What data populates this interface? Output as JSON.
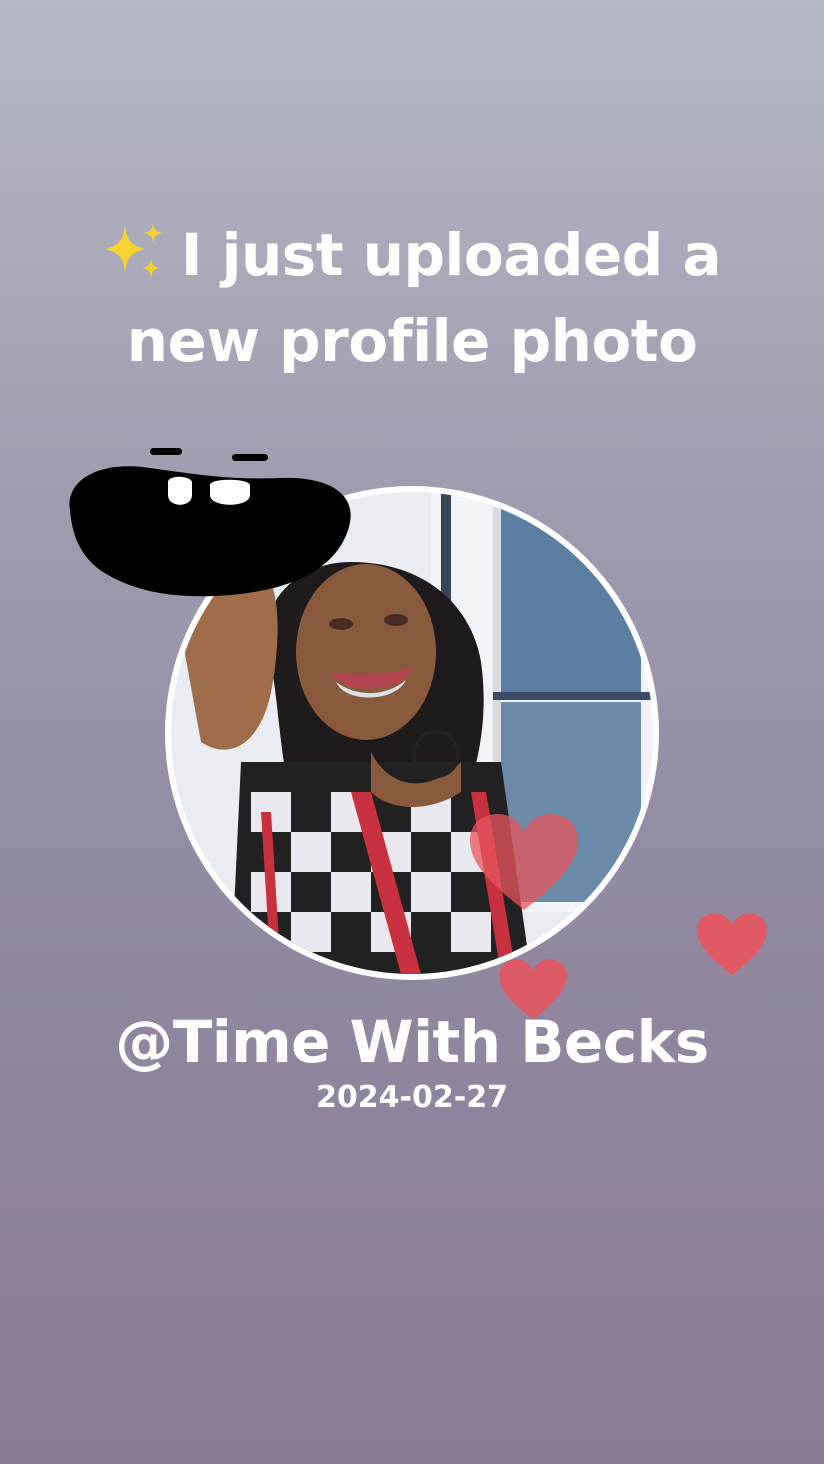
{
  "headline": {
    "line1": "I just uploaded a",
    "line2": "new profile photo",
    "emoji_icon": "sparkles-icon"
  },
  "profile": {
    "username": "@Time With Becks",
    "date": "2024-02-27"
  },
  "stickers": {
    "mouth": "mouth-sticker",
    "hearts": [
      "heart-icon",
      "heart-icon",
      "heart-icon"
    ]
  },
  "colors": {
    "background_top": "#b5b9c6",
    "background_bottom": "#8a7c96",
    "text": "#ffffff",
    "heart": "#e9545c",
    "sparkle": "#f5d33a"
  }
}
